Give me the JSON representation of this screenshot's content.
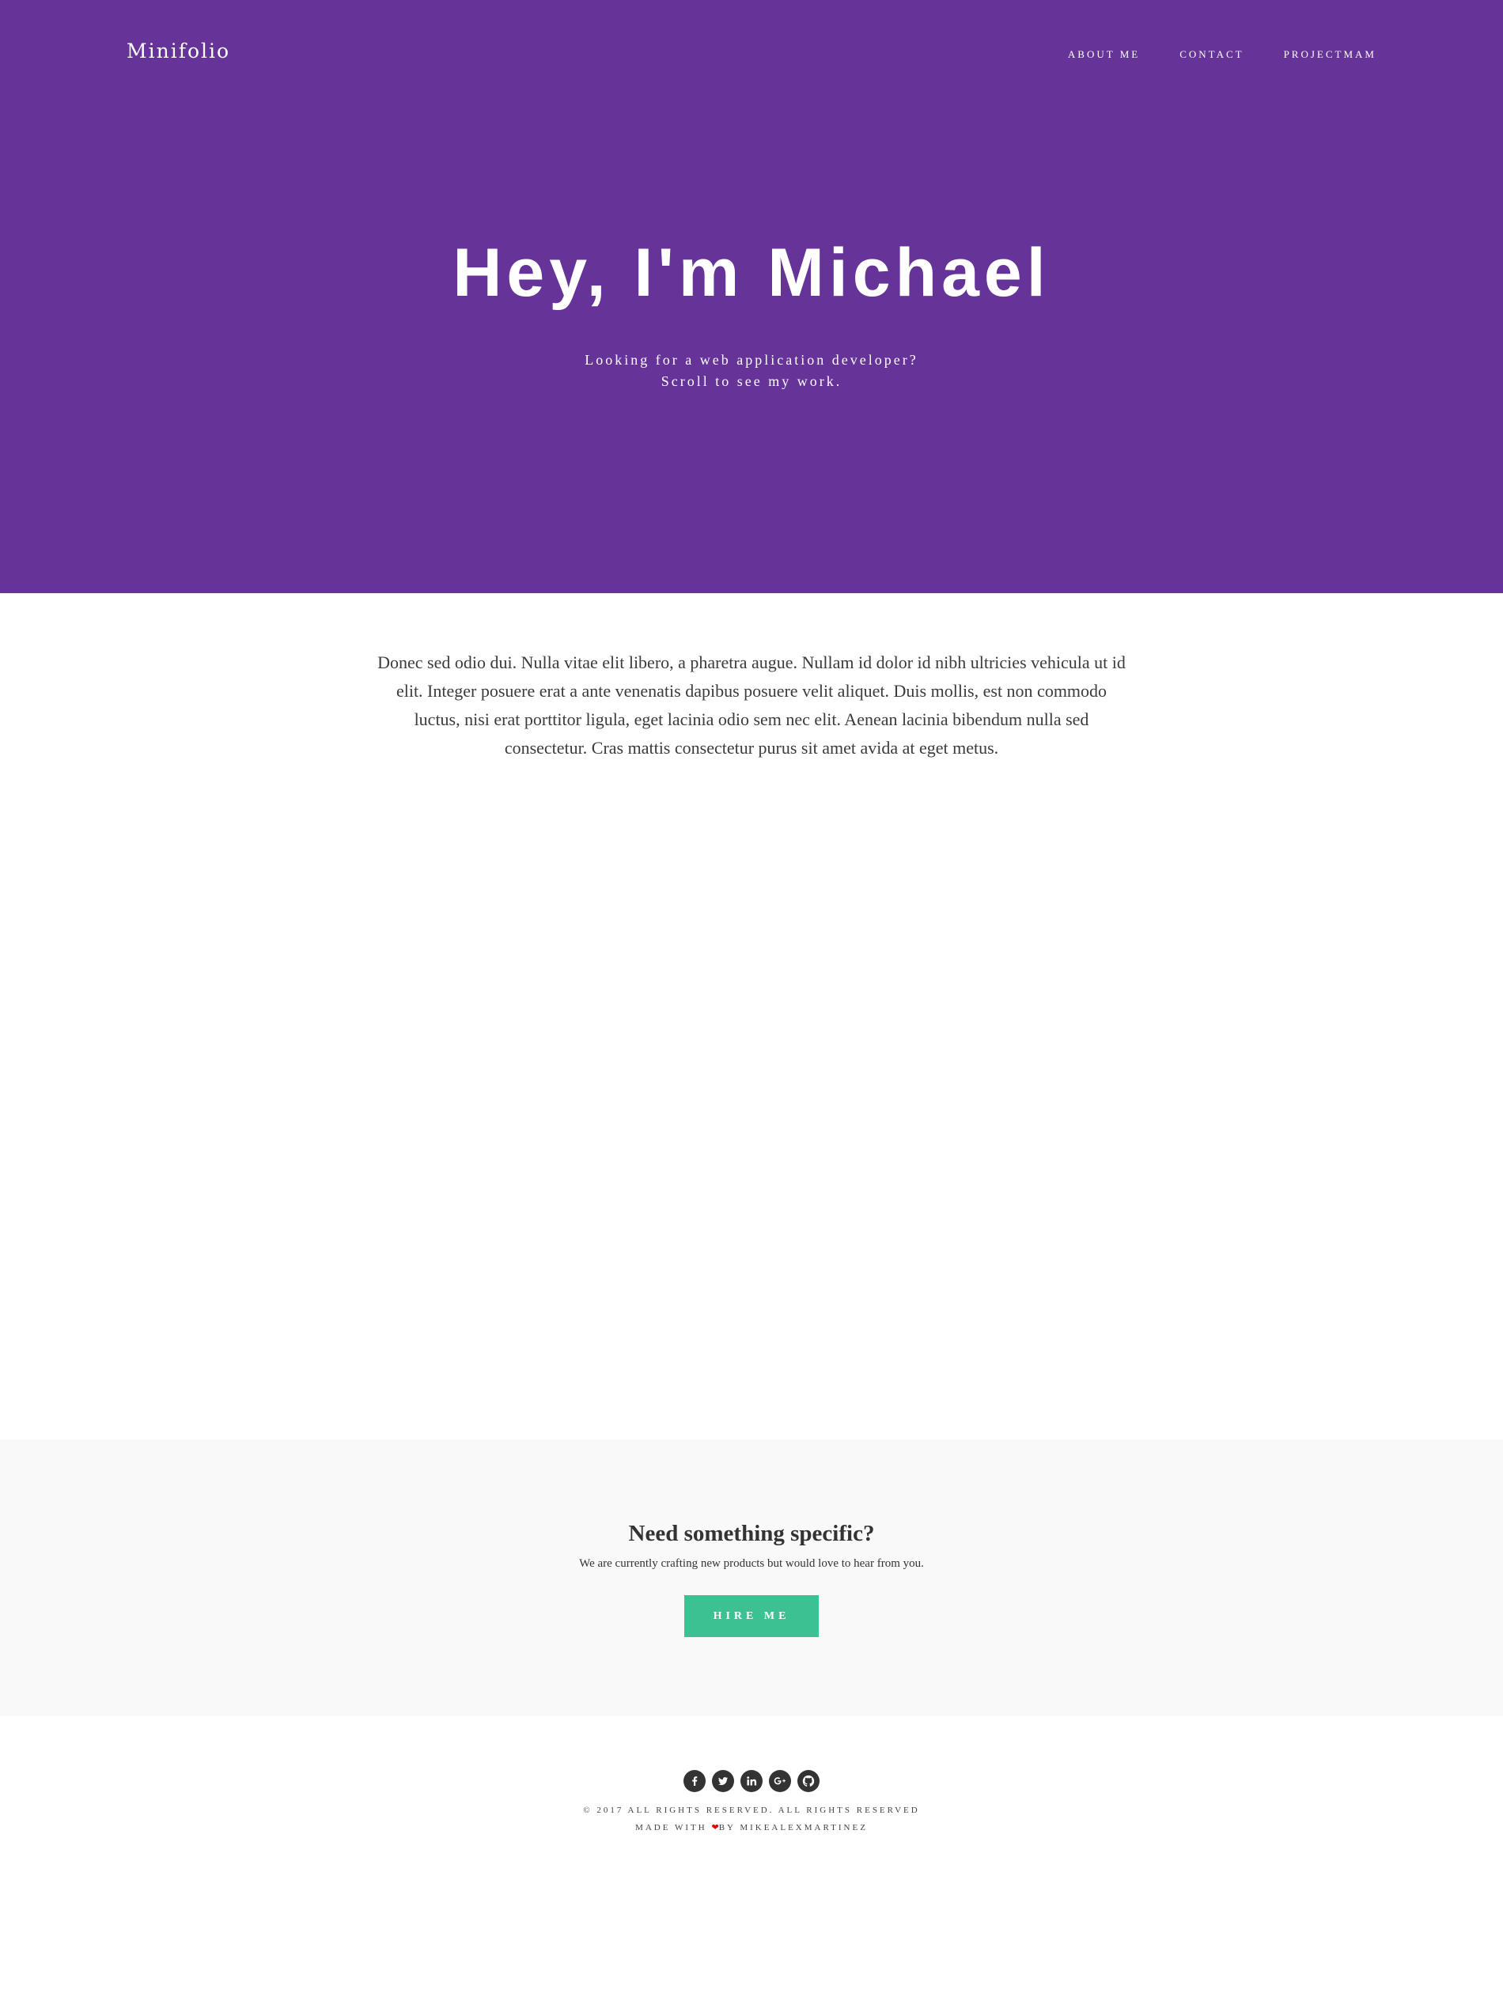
{
  "navbar": {
    "brand": "Minifolio",
    "links": [
      "ABOUT ME",
      "CONTACT",
      "PROJECTMAM"
    ]
  },
  "hero": {
    "title": "Hey, I'm Michael",
    "subtitle_line1": "Looking for a web application developer?",
    "subtitle_line2": "Scroll to see my work."
  },
  "intro": {
    "text": "Donec sed odio dui. Nulla vitae elit libero, a pharetra augue. Nullam id dolor id nibh ultricies vehicula ut id elit. Integer posuere erat a ante venenatis dapibus posuere velit aliquet. Duis mollis, est non commodo luctus, nisi erat porttitor ligula, eget lacinia odio sem nec elit. Aenean lacinia bibendum nulla sed consectetur. Cras mattis consectetur purus sit amet avida at eget metus."
  },
  "cta": {
    "title": "Need something specific?",
    "text": "We are currently crafting new products but would love to hear from you.",
    "button_label": "HIRE ME"
  },
  "footer": {
    "social_icons": [
      "facebook-icon",
      "twitter-icon",
      "linkedin-icon",
      "google-plus-icon",
      "github-icon"
    ],
    "copyright": "© 2017 ALL RIGHTS RESERVED. ALL RIGHTS RESERVED",
    "made_with": "MADE WITH",
    "made_by": "BY",
    "author": "MIKEALEXMARTINEZ"
  },
  "colors": {
    "hero_bg": "#663399",
    "accent": "#3cc193",
    "cta_bg": "#f9f9f9",
    "icon_bg": "#333333",
    "heart": "#e60000"
  }
}
